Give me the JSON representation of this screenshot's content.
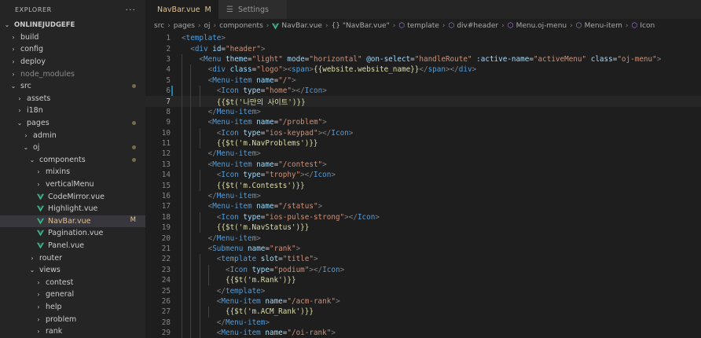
{
  "explorer": {
    "title": "EXPLORER",
    "more": "···",
    "root": "ONLINEJUDGEFE",
    "items": [
      {
        "label": "build",
        "chev": "›",
        "level": 1
      },
      {
        "label": "config",
        "chev": "›",
        "level": 1
      },
      {
        "label": "deploy",
        "chev": "›",
        "level": 1
      },
      {
        "label": "node_modules",
        "chev": "›",
        "level": 1,
        "muted": true
      },
      {
        "label": "src",
        "chev": "⌄",
        "level": 1,
        "dot": true
      },
      {
        "label": "assets",
        "chev": "›",
        "level": 2
      },
      {
        "label": "i18n",
        "chev": "›",
        "level": 2
      },
      {
        "label": "pages",
        "chev": "⌄",
        "level": 2,
        "dot": true
      },
      {
        "label": "admin",
        "chev": "›",
        "level": 3
      },
      {
        "label": "oj",
        "chev": "⌄",
        "level": 3,
        "dot": true
      },
      {
        "label": "components",
        "chev": "⌄",
        "level": 4,
        "dot": true
      },
      {
        "label": "mixins",
        "chev": "›",
        "level": 5
      },
      {
        "label": "verticalMenu",
        "chev": "›",
        "level": 5
      },
      {
        "label": "CodeMirror.vue",
        "vue": true,
        "level": 5
      },
      {
        "label": "Highlight.vue",
        "vue": true,
        "level": 5
      },
      {
        "label": "NavBar.vue",
        "vue": true,
        "level": 5,
        "active": true,
        "badge": "M"
      },
      {
        "label": "Pagination.vue",
        "vue": true,
        "level": 5
      },
      {
        "label": "Panel.vue",
        "vue": true,
        "level": 5
      },
      {
        "label": "router",
        "chev": "›",
        "level": 4
      },
      {
        "label": "views",
        "chev": "⌄",
        "level": 4
      },
      {
        "label": "contest",
        "chev": "›",
        "level": 5
      },
      {
        "label": "general",
        "chev": "›",
        "level": 5
      },
      {
        "label": "help",
        "chev": "›",
        "level": 5
      },
      {
        "label": "problem",
        "chev": "›",
        "level": 5
      },
      {
        "label": "rank",
        "chev": "›",
        "level": 5
      }
    ]
  },
  "tabs": [
    {
      "label": "NavBar.vue",
      "modified": "M",
      "active": true
    },
    {
      "label": "Settings",
      "active": false
    }
  ],
  "breadcrumb": [
    "src",
    "pages",
    "oj",
    "components",
    "NavBar.vue",
    "{} \"NavBar.vue\"",
    "template",
    "div#header",
    "Menu.oj-menu",
    "Menu-item",
    "Icon"
  ],
  "code": {
    "current_line": 7,
    "modified_lines": [
      6,
      7
    ],
    "lines": [
      "<template>",
      "  <div id=\"header\">",
      "    <Menu theme=\"light\" mode=\"horizontal\" @on-select=\"handleRoute\" :active-name=\"activeMenu\" class=\"oj-menu\">",
      "      <div class=\"logo\"><span>{{website.website_name}}</span></div>",
      "      <Menu-item name=\"/\">",
      "        <Icon type=\"home\"></Icon>",
      "        {{$t('나만의 사이트')}}",
      "      </Menu-item>",
      "      <Menu-item name=\"/problem\">",
      "        <Icon type=\"ios-keypad\"></Icon>",
      "        {{$t('m.NavProblems')}}",
      "      </Menu-item>",
      "      <Menu-item name=\"/contest\">",
      "        <Icon type=\"trophy\"></Icon>",
      "        {{$t('m.Contests')}}",
      "      </Menu-item>",
      "      <Menu-item name=\"/status\">",
      "        <Icon type=\"ios-pulse-strong\"></Icon>",
      "        {{$t('m.NavStatus')}}",
      "      </Menu-item>",
      "      <Submenu name=\"rank\">",
      "        <template slot=\"title\">",
      "          <Icon type=\"podium\"></Icon>",
      "          {{$t('m.Rank')}}",
      "        </template>",
      "        <Menu-item name=\"/acm-rank\">",
      "          {{$t('m.ACM_Rank')}}",
      "        </Menu-item>",
      "        <Menu-item name=\"/oi-rank\">"
    ]
  }
}
